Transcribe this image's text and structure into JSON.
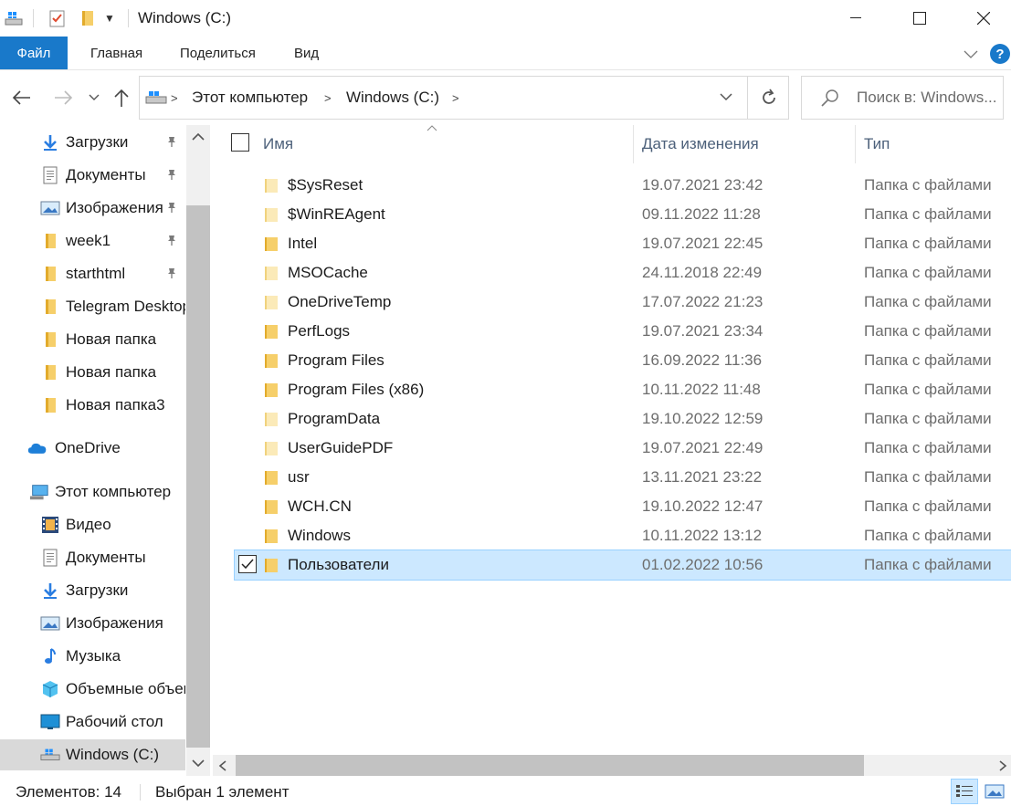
{
  "window": {
    "title": "Windows (C:)",
    "minimize": "—",
    "maximize": "☐",
    "close": "✕"
  },
  "ribbon": {
    "tabs": [
      "Файл",
      "Главная",
      "Поделиться",
      "Вид"
    ],
    "help": "?"
  },
  "address": {
    "segments": [
      "Этот компьютер",
      "Windows (C:)"
    ],
    "search_placeholder": "Поиск в: Windows..."
  },
  "sidebar": {
    "quick_access": [
      {
        "label": "Загрузки",
        "icon": "download-arrow-icon",
        "pinned": true
      },
      {
        "label": "Документы",
        "icon": "document-icon",
        "pinned": true
      },
      {
        "label": "Изображения",
        "icon": "pictures-icon",
        "pinned": true
      },
      {
        "label": "week1",
        "icon": "folder-icon",
        "pinned": true
      },
      {
        "label": "starthtml",
        "icon": "folder-icon",
        "pinned": true
      },
      {
        "label": "Telegram Desktop",
        "icon": "folder-icon",
        "pinned": false
      },
      {
        "label": "Новая папка",
        "icon": "folder-icon",
        "pinned": false
      },
      {
        "label": "Новая папка",
        "icon": "folder-icon",
        "pinned": false
      },
      {
        "label": "Новая папка3",
        "icon": "folder-icon",
        "pinned": false
      }
    ],
    "onedrive": "OneDrive",
    "this_pc": "Этот компьютер",
    "pc_items": [
      {
        "label": "Видео",
        "icon": "video-icon"
      },
      {
        "label": "Документы",
        "icon": "document-icon"
      },
      {
        "label": "Загрузки",
        "icon": "download-arrow-icon"
      },
      {
        "label": "Изображения",
        "icon": "pictures-icon"
      },
      {
        "label": "Музыка",
        "icon": "music-note-icon"
      },
      {
        "label": "Объемные объекты",
        "icon": "3d-objects-icon"
      },
      {
        "label": "Рабочий стол",
        "icon": "desktop-icon"
      },
      {
        "label": "Windows (C:)",
        "icon": "drive-icon",
        "selected": true
      }
    ]
  },
  "columns": {
    "name": "Имя",
    "date": "Дата изменения",
    "type": "Тип"
  },
  "files": [
    {
      "name": "$SysReset",
      "date": "19.07.2021 23:42",
      "type": "Папка с файлами",
      "hidden": true
    },
    {
      "name": "$WinREAgent",
      "date": "09.11.2022 11:28",
      "type": "Папка с файлами",
      "hidden": true
    },
    {
      "name": "Intel",
      "date": "19.07.2021 22:45",
      "type": "Папка с файлами",
      "hidden": false
    },
    {
      "name": "MSOCache",
      "date": "24.11.2018 22:49",
      "type": "Папка с файлами",
      "hidden": true
    },
    {
      "name": "OneDriveTemp",
      "date": "17.07.2022 21:23",
      "type": "Папка с файлами",
      "hidden": true
    },
    {
      "name": "PerfLogs",
      "date": "19.07.2021 23:34",
      "type": "Папка с файлами",
      "hidden": false
    },
    {
      "name": "Program Files",
      "date": "16.09.2022 11:36",
      "type": "Папка с файлами",
      "hidden": false
    },
    {
      "name": "Program Files (x86)",
      "date": "10.11.2022 11:48",
      "type": "Папка с файлами",
      "hidden": false
    },
    {
      "name": "ProgramData",
      "date": "19.10.2022 12:59",
      "type": "Папка с файлами",
      "hidden": true
    },
    {
      "name": "UserGuidePDF",
      "date": "19.07.2021 22:49",
      "type": "Папка с файлами",
      "hidden": true
    },
    {
      "name": "usr",
      "date": "13.11.2021 23:22",
      "type": "Папка с файлами",
      "hidden": false
    },
    {
      "name": "WCH.CN",
      "date": "19.10.2022 12:47",
      "type": "Папка с файлами",
      "hidden": false
    },
    {
      "name": "Windows",
      "date": "10.11.2022 13:12",
      "type": "Папка с файлами",
      "hidden": false
    },
    {
      "name": "Пользователи",
      "date": "01.02.2022 10:56",
      "type": "Папка с файлами",
      "hidden": false,
      "selected": true
    }
  ],
  "status": {
    "count": "Элементов: 14",
    "selection": "Выбран 1 элемент"
  },
  "colors": {
    "accent": "#1979ca",
    "selection": "#cce8ff",
    "folder": "#f6cf6a"
  }
}
